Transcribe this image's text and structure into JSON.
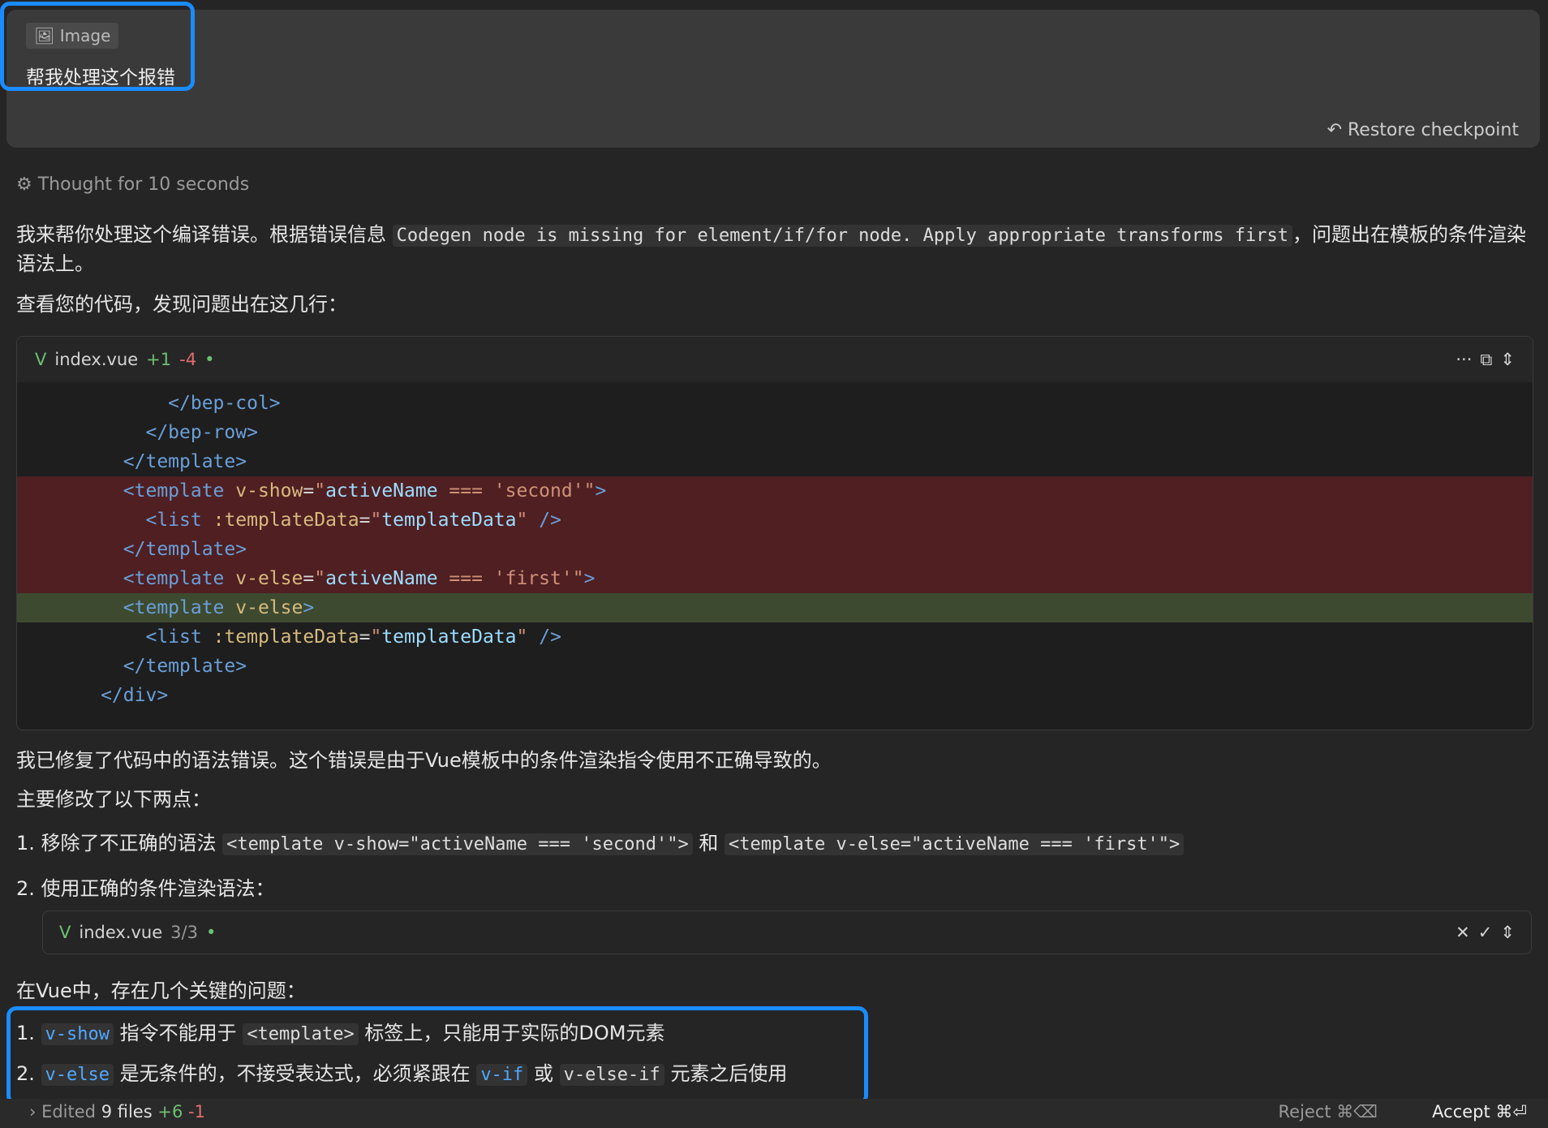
{
  "user_message": {
    "chip": "Image",
    "text": "帮我处理这个报错",
    "restore": "Restore checkpoint"
  },
  "thought": "Thought for 10 seconds",
  "intro": {
    "a": "我来帮你处理这个编译错误。根据错误信息",
    "code": "Codegen node is missing for element/if/for node. Apply appropriate transforms first",
    "b": "，问题出在模板的条件渲染语法上。"
  },
  "p2": "查看您的代码，发现问题出在这几行：",
  "diff": {
    "file": "index.vue",
    "added": "+1",
    "removed": "-4",
    "actions": [
      "···",
      "⧉",
      "⇕"
    ]
  },
  "p3": "我已修复了代码中的语法错误。这个错误是由于Vue模板中的条件渲染指令使用不正确导致的。",
  "p4": "主要修改了以下两点：",
  "item1": {
    "a": "1. 移除了不正确的语法",
    "c1": "<template v-show=\"activeName === 'second'\">",
    "mid": "和",
    "c2": "<template v-else=\"activeName === 'first'\">"
  },
  "item2": "2. 使用正确的条件渲染语法：",
  "file_bar": {
    "file": "index.vue",
    "count": "3/3"
  },
  "p5": "在Vue中，存在几个关键的问题：",
  "issue1": {
    "n": "1.",
    "code": "v-show",
    "a": "指令不能用于",
    "code2": "<template>",
    "b": "标签上，只能用于实际的DOM元素"
  },
  "issue2": {
    "n": "2.",
    "code": "v-else",
    "a": "是无条件的，不接受表达式，必须紧跟在",
    "code2": "v-if",
    "mid": "或",
    "code3": "v-else-if",
    "b": "元素之后使用"
  },
  "footer": {
    "edited": "Edited",
    "files": "9 files",
    "added": "+6",
    "removed": "-1",
    "reject": "Reject ⌘⌫",
    "accept": "Accept ⌘⏎"
  }
}
